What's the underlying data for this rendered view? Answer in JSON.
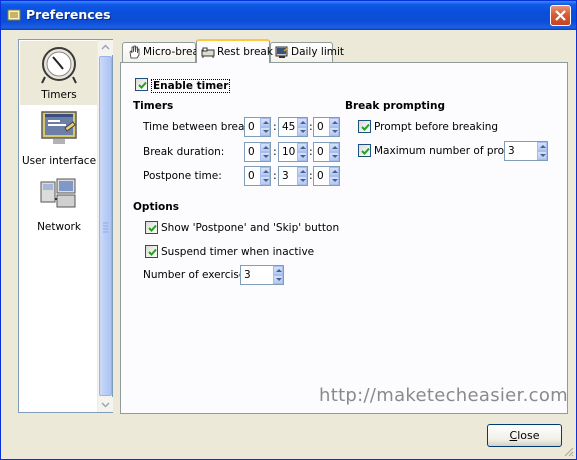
{
  "window": {
    "title": "Preferences"
  },
  "sidebar": {
    "items": [
      {
        "label": "Timers",
        "icon": "clock-icon",
        "selected": true
      },
      {
        "label": "User interface",
        "icon": "monitor-ui-icon",
        "selected": false
      },
      {
        "label": "Network",
        "icon": "network-computers-icon",
        "selected": false
      }
    ]
  },
  "tabs": [
    {
      "label": "Micro-break",
      "icon": "hand-icon",
      "active": false
    },
    {
      "label": "Rest break",
      "icon": "rest-break-icon",
      "active": true
    },
    {
      "label": "Daily limit",
      "icon": "daily-limit-icon",
      "active": false
    }
  ],
  "rest_break": {
    "enable_timer_label": "Enable timer",
    "enable_timer_checked": true,
    "timers_heading": "Timers",
    "time_between_label": "Time between breaks:",
    "time_between": {
      "h": "0",
      "m": "45",
      "s": "0"
    },
    "break_duration_label": "Break duration:",
    "break_duration": {
      "h": "0",
      "m": "10",
      "s": "0"
    },
    "postpone_label": "Postpone time:",
    "postpone": {
      "h": "0",
      "m": "3",
      "s": "0"
    },
    "colon": ":",
    "prompting_heading": "Break prompting",
    "prompt_before_label": "Prompt before breaking",
    "prompt_before_checked": true,
    "max_prompts_label": "Maximum number of prompts:",
    "max_prompts_checked": true,
    "max_prompts_value": "3",
    "options_heading": "Options",
    "show_postpone_skip_label": "Show 'Postpone' and 'Skip' button",
    "show_postpone_skip_checked": true,
    "suspend_inactive_label": "Suspend timer when inactive",
    "suspend_inactive_checked": true,
    "num_exercises_label": "Number of exercises:",
    "num_exercises_value": "3"
  },
  "watermark": "http://maketecheasier.com",
  "footer": {
    "close_label_first": "C",
    "close_label_rest": "lose"
  },
  "colors": {
    "titlebar": "#0a4fdc",
    "dialog_bg": "#ECE9D8",
    "tab_highlight": "#ffc73c",
    "check_mark": "#21a121"
  }
}
